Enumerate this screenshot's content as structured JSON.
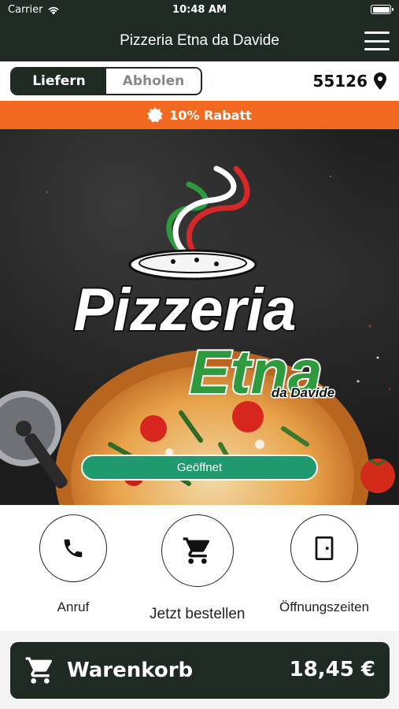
{
  "status_bar": {
    "carrier": "Carrier",
    "time": "10:48 AM"
  },
  "header": {
    "title": "Pizzeria Etna da Davide"
  },
  "mode_toggle": {
    "deliver": "Liefern",
    "pickup": "Abholen",
    "selected": "Liefern"
  },
  "location": {
    "zip": "55126"
  },
  "discount_banner": {
    "text": "10% Rabatt"
  },
  "logo": {
    "line1": "Pizzeria",
    "line2": "Etna",
    "line3": "da Davide"
  },
  "status": {
    "open_label": "Geöffnet"
  },
  "actions": {
    "call": "Anruf",
    "order": "Jetzt bestellen",
    "hours": "Öffnungszeiten"
  },
  "cart": {
    "label": "Warenkorb",
    "total": "18,45 €"
  },
  "colors": {
    "header_bg": "#1f2a22",
    "accent_orange": "#f26a21",
    "open_green": "#1f9a6e",
    "logo_green": "#2e9a3e",
    "logo_red": "#d62828"
  },
  "icons": {
    "menu": "hamburger-menu-icon",
    "location": "map-pin-icon",
    "discount": "badge-star-icon",
    "call": "phone-icon",
    "order": "shopping-cart-icon",
    "hours": "door-icon",
    "cart": "shopping-cart-icon"
  }
}
